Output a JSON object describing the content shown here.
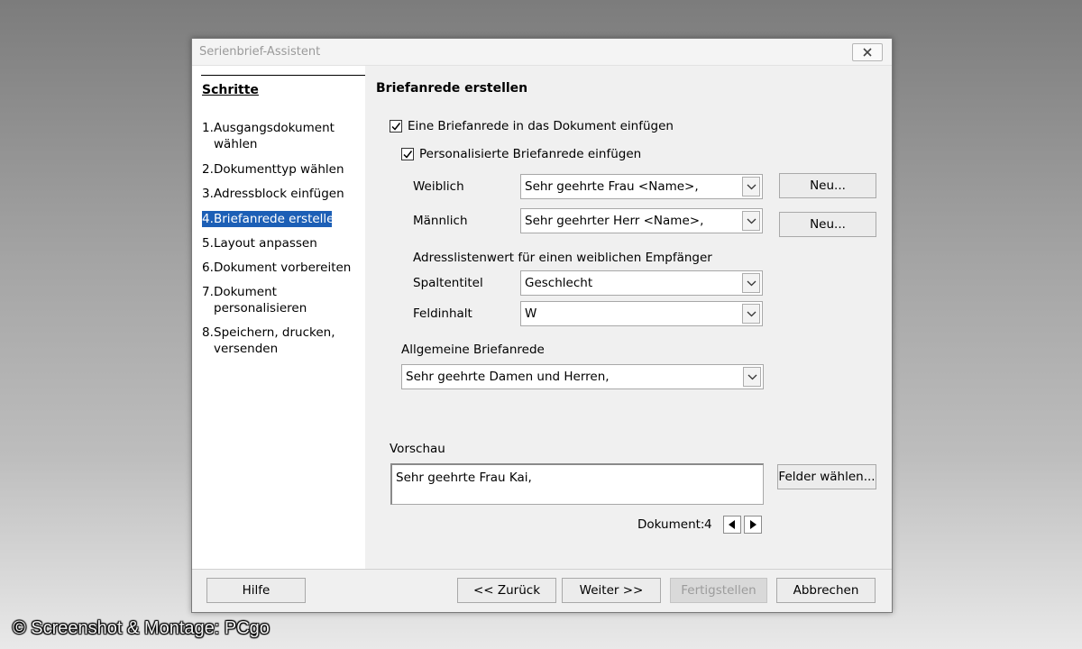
{
  "window": {
    "title": "Serienbrief-Assistent"
  },
  "sidebar": {
    "title": "Schritte",
    "steps": [
      {
        "num": "1.",
        "label": "Ausgangsdokument wählen",
        "lines": [
          "Ausgangsdokument",
          "wählen"
        ]
      },
      {
        "num": "2.",
        "label": "Dokumenttyp wählen"
      },
      {
        "num": "3.",
        "label": "Adressblock einfügen"
      },
      {
        "num": "4.",
        "label": "Briefanrede erstellen",
        "active": true
      },
      {
        "num": "5.",
        "label": "Layout anpassen"
      },
      {
        "num": "6.",
        "label": "Dokument vorbereiten"
      },
      {
        "num": "7.",
        "label": "Dokument personalisieren",
        "lines": [
          "Dokument",
          "personalisieren"
        ]
      },
      {
        "num": "8.",
        "label": "Speichern, drucken, versenden",
        "lines": [
          "Speichern, drucken,",
          "versenden"
        ]
      }
    ]
  },
  "main": {
    "heading": "Briefanrede erstellen",
    "insert_salutation": {
      "label": "Eine Briefanrede in das Dokument einfügen",
      "checked": true
    },
    "personalized": {
      "label": "Personalisierte Briefanrede einfügen",
      "checked": true
    },
    "female": {
      "label": "Weiblich",
      "value": "Sehr geehrte Frau <Name>,",
      "new_label": "Neu..."
    },
    "male": {
      "label": "Männlich",
      "value": "Sehr geehrter Herr <Name>,",
      "new_label": "Neu..."
    },
    "address_list_caption": "Adresslistenwert für einen weiblichen Empfänger",
    "column_title": {
      "label": "Spaltentitel",
      "value": "Geschlecht"
    },
    "field_content": {
      "label": "Feldinhalt",
      "value": "W"
    },
    "general": {
      "label": "Allgemeine Briefanrede",
      "value": "Sehr geehrte Damen und Herren,"
    },
    "preview": {
      "label": "Vorschau",
      "text": "Sehr geehrte Frau Kai,",
      "choose_fields_label": "Felder wählen..."
    },
    "document_nav": {
      "label": "Dokument:",
      "value": "4"
    }
  },
  "footer": {
    "help": "Hilfe",
    "back": "<< Zurück",
    "next": "Weiter >>",
    "finish": "Fertigstellen",
    "cancel": "Abbrechen"
  },
  "watermark": "© Screenshot & Montage: PCgo",
  "colors": {
    "selection": "#1c5fb6",
    "dialog_bg": "#f0f0f0"
  }
}
